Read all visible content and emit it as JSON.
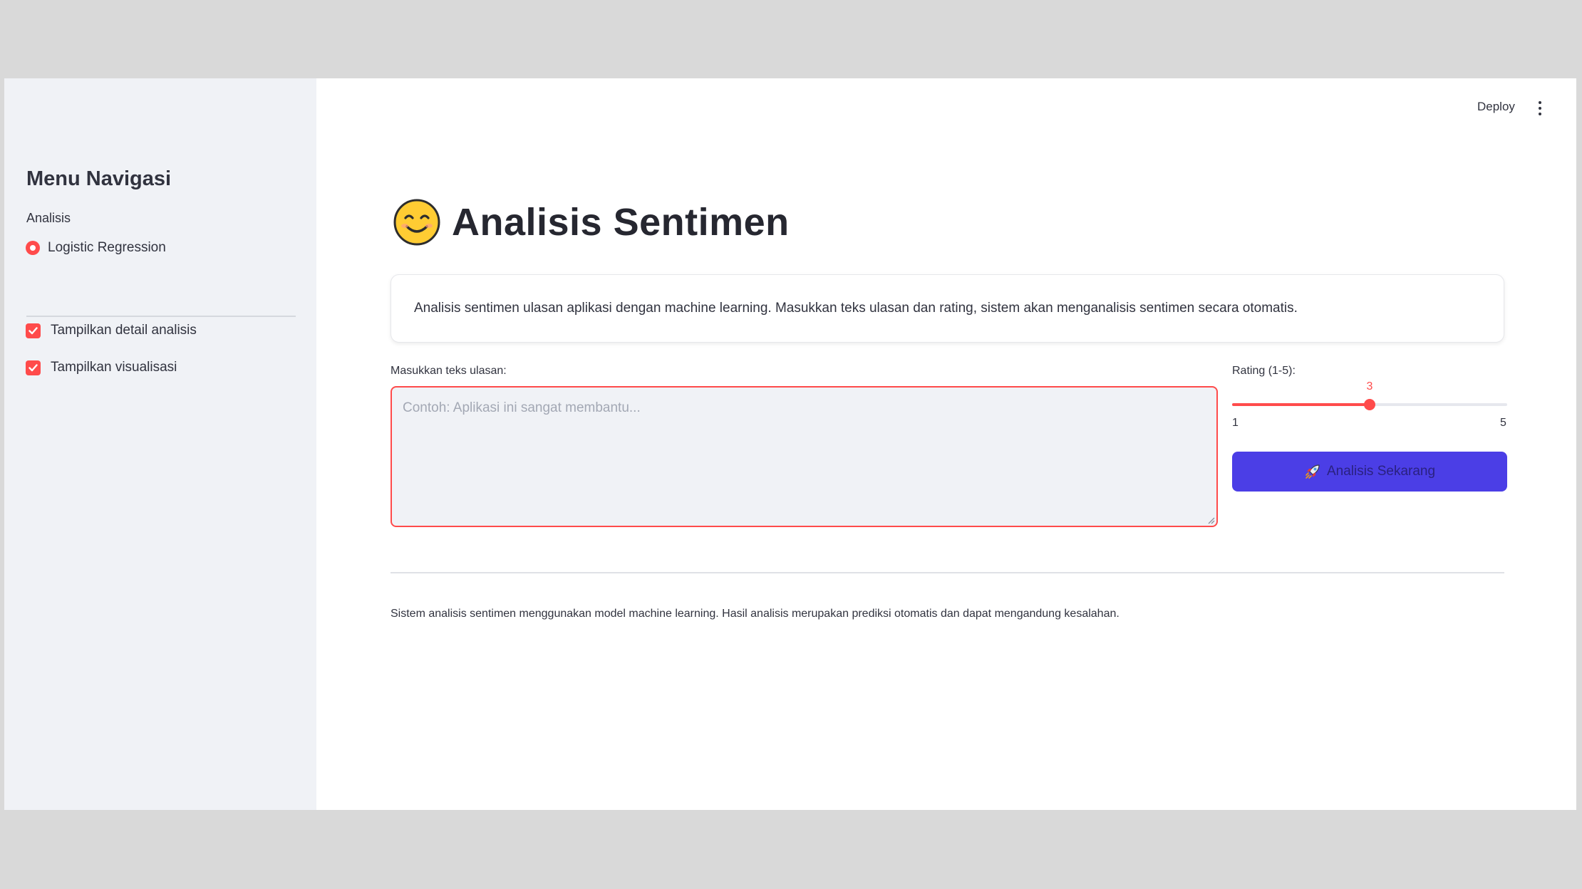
{
  "topbar": {
    "deploy_label": "Deploy",
    "menu_icon": "more-vertical-icon"
  },
  "sidebar": {
    "title": "Menu Navigasi",
    "radio_group_label": "Analisis",
    "radio_options": [
      {
        "label": "Logistic Regression",
        "selected": true
      }
    ],
    "checkboxes": [
      {
        "label": "Tampilkan detail analisis",
        "checked": true
      },
      {
        "label": "Tampilkan visualisasi",
        "checked": true
      }
    ]
  },
  "main": {
    "title_emoji": "smiling-face-icon",
    "title": "Analisis Sentimen",
    "info_text": "Analisis sentimen ulasan aplikasi dengan machine learning. Masukkan teks ulasan dan rating, sistem akan menganalisis sentimen secara otomatis.",
    "review_input": {
      "label": "Masukkan teks ulasan:",
      "placeholder": "Contoh: Aplikasi ini sangat membantu...",
      "value": ""
    },
    "rating": {
      "label": "Rating (1-5):",
      "min": 1,
      "max": 5,
      "value": 3,
      "min_label": "1",
      "max_label": "5",
      "value_label": "3"
    },
    "analyze_button": {
      "icon": "rocket-icon",
      "label": "Analisis Sekarang"
    },
    "footer_text": "Sistem analisis sentimen menggunakan model machine learning. Hasil analisis merupakan prediksi otomatis dan dapat mengandung kesalahan."
  },
  "colors": {
    "accent": "#ff4b4b",
    "button": "#4b3ee6",
    "sidebar_bg": "#f0f2f6"
  }
}
